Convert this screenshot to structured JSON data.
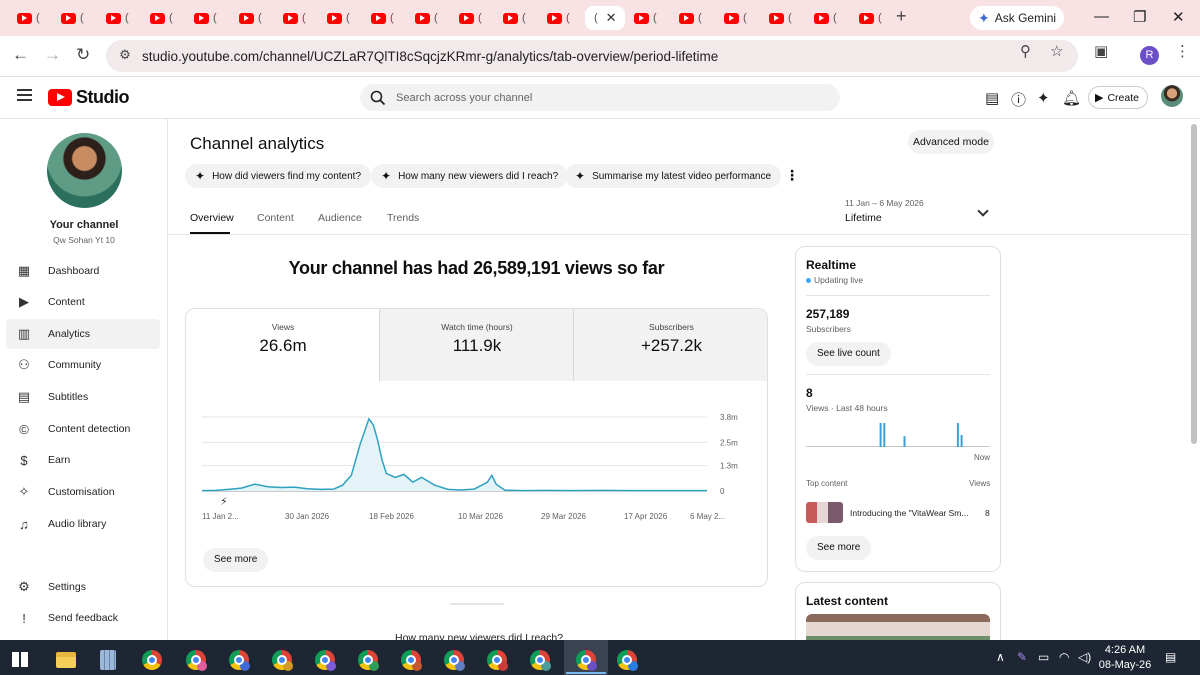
{
  "browser": {
    "active_tab_close": "✕",
    "new_tab": "+",
    "gemini_label": "Ask Gemini",
    "url": "studio.youtube.com/channel/UCZLaR7QlTI8cSqcjzKRmr-g/analytics/tab-overview/period-lifetime",
    "profile_initial": "R"
  },
  "header": {
    "logo_text": "Studio",
    "search_placeholder": "Search across your channel",
    "create_label": "Create"
  },
  "sidebar": {
    "your_channel": "Your channel",
    "channel_name": "Qw Sohan Yt 10",
    "items": [
      {
        "label": "Dashboard",
        "icon": "dashboard-icon"
      },
      {
        "label": "Content",
        "icon": "content-icon"
      },
      {
        "label": "Analytics",
        "icon": "analytics-icon"
      },
      {
        "label": "Community",
        "icon": "community-icon"
      },
      {
        "label": "Subtitles",
        "icon": "subtitles-icon"
      },
      {
        "label": "Content detection",
        "icon": "copyright-icon"
      },
      {
        "label": "Earn",
        "icon": "dollar-icon"
      },
      {
        "label": "Customisation",
        "icon": "magic-wand-icon"
      },
      {
        "label": "Audio library",
        "icon": "audio-library-icon"
      }
    ],
    "settings": "Settings",
    "feedback": "Send feedback"
  },
  "main": {
    "title": "Channel analytics",
    "advanced_mode": "Advanced mode",
    "chips": [
      "How did viewers find my content?",
      "How many new viewers did I reach?",
      "Summarise my latest video performance"
    ],
    "tabs": [
      "Overview",
      "Content",
      "Audience",
      "Trends"
    ],
    "period_range": "11 Jan – 6 May 2026",
    "period_label": "Lifetime",
    "headline": "Your channel has had 26,589,191 views so far",
    "metrics": [
      {
        "label": "Views",
        "value": "26.6m"
      },
      {
        "label": "Watch time (hours)",
        "value": "111.9k"
      },
      {
        "label": "Subscribers",
        "value": "+257.2k"
      }
    ],
    "see_more": "See more",
    "below_text": "How many new viewers did I reach?"
  },
  "chart_data": {
    "type": "area",
    "x": [
      "2026-01-11",
      "2026-01-14",
      "2026-01-17",
      "2026-01-20",
      "2026-01-23",
      "2026-01-26",
      "2026-01-29",
      "2026-02-01",
      "2026-02-04",
      "2026-02-07",
      "2026-02-10",
      "2026-02-12",
      "2026-02-14",
      "2026-02-16",
      "2026-02-18",
      "2026-02-19",
      "2026-02-20",
      "2026-02-21",
      "2026-02-22",
      "2026-02-24",
      "2026-02-26",
      "2026-02-28",
      "2026-03-02",
      "2026-03-05",
      "2026-03-08",
      "2026-03-11",
      "2026-03-14",
      "2026-03-17",
      "2026-03-18",
      "2026-03-19",
      "2026-03-21",
      "2026-03-25",
      "2026-03-30",
      "2026-04-05",
      "2026-04-12",
      "2026-04-19",
      "2026-04-26",
      "2026-05-03",
      "2026-05-06"
    ],
    "values": [
      0.02,
      0.03,
      0.08,
      0.15,
      0.35,
      0.22,
      0.18,
      0.2,
      0.12,
      0.08,
      0.1,
      0.3,
      0.8,
      2.4,
      3.7,
      3.4,
      2.6,
      1.6,
      0.9,
      0.7,
      0.85,
      0.45,
      0.7,
      0.3,
      0.08,
      0.05,
      0.1,
      0.45,
      0.8,
      0.35,
      0.04,
      0.02,
      0.03,
      0.02,
      0.03,
      0.02,
      0.02,
      0.02,
      0.02
    ],
    "x_tick_labels": [
      "11 Jan 2...",
      "30 Jan 2026",
      "18 Feb 2026",
      "10 Mar 2026",
      "29 Mar 2026",
      "17 Apr 2026",
      "6 May 2..."
    ],
    "y_ticks": [
      0,
      1.3,
      2.5,
      3.8
    ],
    "y_tick_labels": [
      "0",
      "1.3m",
      "2.5m",
      "3.8m"
    ],
    "ylim": [
      0,
      3.8
    ],
    "series": [
      {
        "values": "views"
      }
    ],
    "grid": true,
    "color": "#2ea1bf"
  },
  "realtime": {
    "title": "Realtime",
    "live": "Updating live",
    "subscribers_value": "257,189",
    "subscribers_label": "Subscribers",
    "see_live": "See live count",
    "views_value": "8",
    "views_label": "Views · Last 48 hours",
    "now_label": "Now",
    "bars": [
      0,
      0,
      0,
      0,
      0,
      0,
      0,
      0,
      0,
      0,
      0,
      0,
      0,
      0,
      0,
      0,
      0,
      0,
      0,
      0,
      0,
      0,
      0,
      0,
      0,
      0,
      0,
      0,
      0,
      0,
      0,
      0,
      0,
      0,
      0,
      0,
      0,
      0,
      0,
      0,
      0,
      0,
      0,
      0,
      0,
      0,
      0,
      0,
      0,
      0,
      0,
      0,
      0,
      0,
      0,
      0,
      0,
      0,
      0,
      0,
      0,
      0,
      0,
      0,
      0,
      0,
      0,
      0,
      0,
      0,
      0,
      0,
      0,
      0,
      0,
      0,
      0,
      0,
      0,
      0,
      0,
      0,
      0,
      0,
      0,
      0,
      0,
      0,
      0,
      0,
      0,
      0,
      0,
      0,
      0,
      0,
      0,
      0,
      0,
      0,
      0,
      0,
      0,
      0,
      0,
      0,
      0,
      0,
      0,
      0,
      0,
      0,
      0,
      0,
      0,
      0,
      0,
      0,
      0,
      0,
      0,
      0,
      0,
      0,
      0,
      0,
      0,
      0,
      0,
      0,
      0,
      0,
      0,
      0,
      0,
      0,
      0,
      0,
      0,
      0,
      0,
      0,
      0,
      0,
      0,
      0,
      0,
      0,
      0,
      0,
      0,
      0,
      0,
      0,
      0,
      0,
      0,
      0,
      0,
      0,
      0,
      0,
      0,
      0,
      0,
      0,
      0,
      0,
      0,
      0,
      0,
      0,
      0,
      0,
      0,
      0,
      0,
      0,
      0,
      0,
      0,
      0,
      0,
      0,
      0,
      0,
      0,
      0,
      0,
      0
    ],
    "bar_spikes": [
      {
        "pos": 0.4,
        "v": 1.0
      },
      {
        "pos": 0.42,
        "v": 1.0
      },
      {
        "pos": 0.53,
        "v": 0.45
      },
      {
        "pos": 0.82,
        "v": 1.0
      },
      {
        "pos": 0.84,
        "v": 0.5
      }
    ],
    "top_content": "Top content",
    "views_col": "Views",
    "top_title": "Introducing the \"VitaWear Sm...",
    "top_views": "8",
    "see_more": "See more",
    "latest_content": "Latest content"
  },
  "taskbar": {
    "time": "4:26 AM",
    "date": "08-May-26"
  }
}
